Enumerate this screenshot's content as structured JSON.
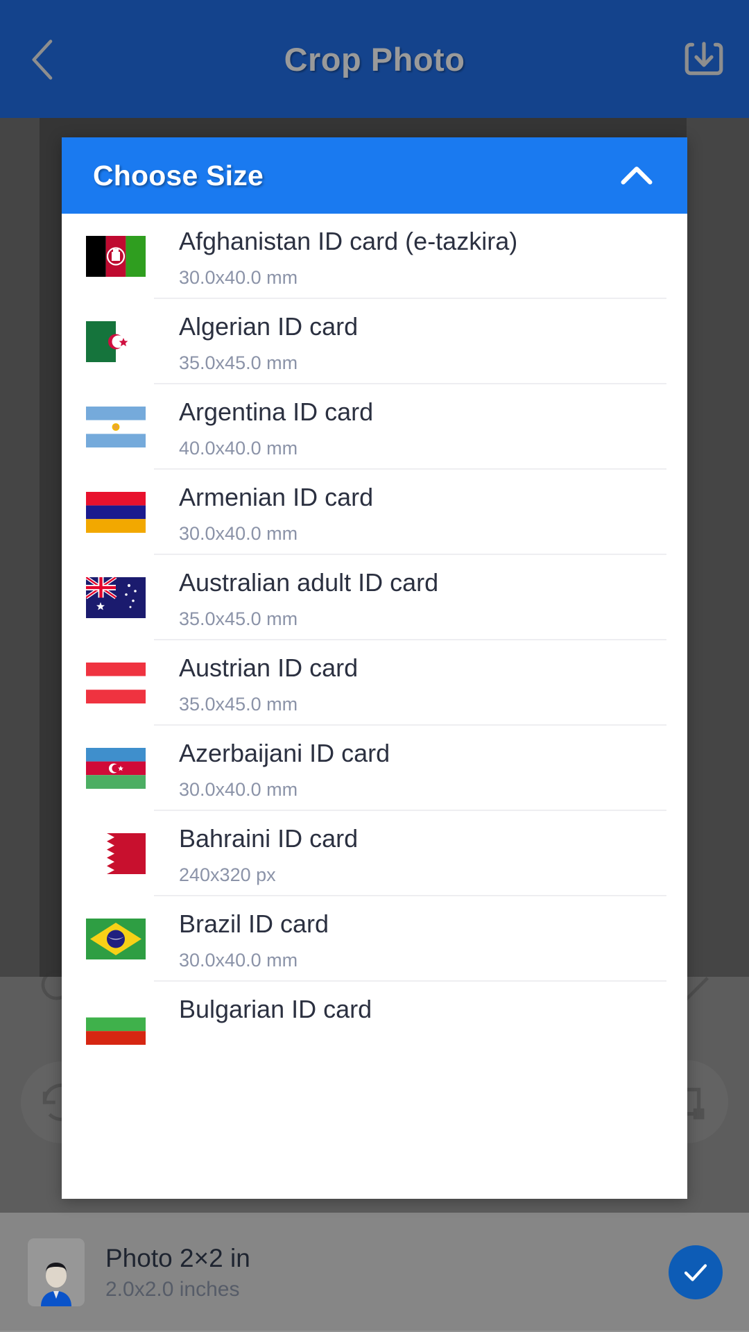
{
  "appbar": {
    "title": "Crop Photo",
    "back_icon": "chevron-left-icon",
    "save_icon": "download-save-icon"
  },
  "dialog": {
    "title": "Choose Size",
    "collapse_icon": "chevron-up-icon",
    "items": [
      {
        "label": "Afghanistan ID card (e-tazkira)",
        "size": "30.0x40.0 mm",
        "flag": "afghanistan"
      },
      {
        "label": "Algerian ID card",
        "size": "35.0x45.0 mm",
        "flag": "algeria"
      },
      {
        "label": "Argentina ID card",
        "size": "40.0x40.0 mm",
        "flag": "argentina"
      },
      {
        "label": "Armenian ID card",
        "size": "30.0x40.0 mm",
        "flag": "armenia"
      },
      {
        "label": "Australian adult ID card",
        "size": "35.0x45.0 mm",
        "flag": "australia"
      },
      {
        "label": "Austrian ID card",
        "size": "35.0x45.0 mm",
        "flag": "austria"
      },
      {
        "label": "Azerbaijani ID card",
        "size": "30.0x40.0 mm",
        "flag": "azerbaijan"
      },
      {
        "label": "Bahraini ID card",
        "size": "240x320 px",
        "flag": "bahrain"
      },
      {
        "label": "Brazil ID card",
        "size": "30.0x40.0 mm",
        "flag": "brazil"
      },
      {
        "label": "Bulgarian ID card",
        "size": "",
        "flag": "bulgaria"
      }
    ]
  },
  "bottombar": {
    "selected_title": "Photo 2×2 in",
    "selected_sub": "2.0x2.0 inches",
    "thumb_icon": "person-portrait-icon",
    "confirm_icon": "check-icon"
  },
  "colors": {
    "appbar": "#14438c",
    "dialog_header": "#1a7af0",
    "confirm": "#0d5cb6",
    "title_text": "#9a9a9a",
    "item_title": "#2b3040",
    "item_sub": "#8b93a8"
  }
}
